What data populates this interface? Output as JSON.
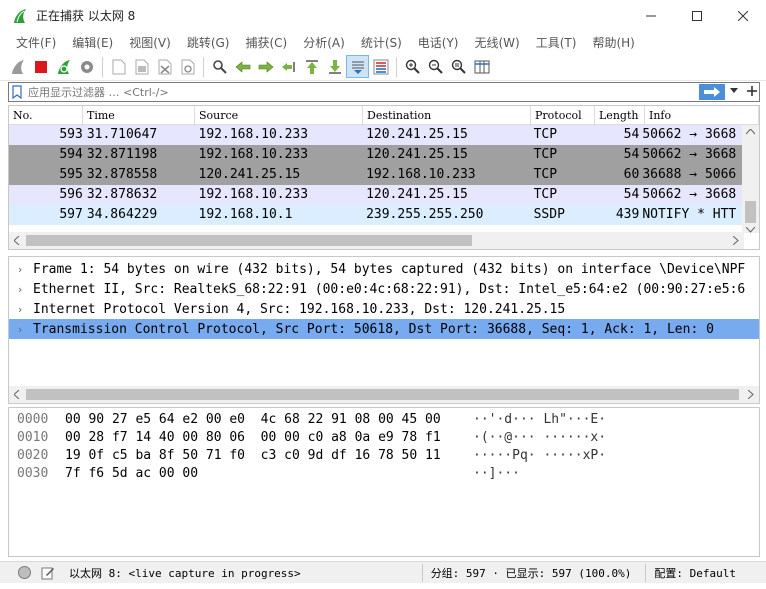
{
  "window": {
    "title": "正在捕获 以太网 8"
  },
  "menu": [
    "文件(F)",
    "编辑(E)",
    "视图(V)",
    "跳转(G)",
    "捕获(C)",
    "分析(A)",
    "统计(S)",
    "电话(Y)",
    "无线(W)",
    "工具(T)",
    "帮助(H)"
  ],
  "filter": {
    "placeholder": "应用显示过滤器 … <Ctrl-/>"
  },
  "packet_list": {
    "columns": [
      "No.",
      "Time",
      "Source",
      "Destination",
      "Protocol",
      "Length",
      "Info"
    ],
    "rows": [
      {
        "no": "593",
        "time": "31.710647",
        "src": "192.168.10.233",
        "dst": "120.241.25.15",
        "proto": "TCP",
        "len": "54",
        "info": "50662 → 3668",
        "bg": "#e7e6ff"
      },
      {
        "no": "594",
        "time": "32.871198",
        "src": "192.168.10.233",
        "dst": "120.241.25.15",
        "proto": "TCP",
        "len": "54",
        "info": "50662 → 3668",
        "bg": "#a0a0a0"
      },
      {
        "no": "595",
        "time": "32.878558",
        "src": "120.241.25.15",
        "dst": "192.168.10.233",
        "proto": "TCP",
        "len": "60",
        "info": "36688 → 5066",
        "bg": "#a0a0a0"
      },
      {
        "no": "596",
        "time": "32.878632",
        "src": "192.168.10.233",
        "dst": "120.241.25.15",
        "proto": "TCP",
        "len": "54",
        "info": "50662 → 3668",
        "bg": "#e7e6ff"
      },
      {
        "no": "597",
        "time": "34.864229",
        "src": "192.168.10.1",
        "dst": "239.255.255.250",
        "proto": "SSDP",
        "len": "439",
        "info": "NOTIFY * HTT",
        "bg": "#daeeff"
      }
    ]
  },
  "details": [
    "Frame 1: 54 bytes on wire (432 bits), 54 bytes captured (432 bits) on interface \\Device\\NPF",
    "Ethernet II, Src: RealtekS_68:22:91 (00:e0:4c:68:22:91), Dst: Intel_e5:64:e2 (00:90:27:e5:6",
    "Internet Protocol Version 4, Src: 192.168.10.233, Dst: 120.241.25.15",
    "Transmission Control Protocol, Src Port: 50618, Dst Port: 36688, Seq: 1, Ack: 1, Len: 0"
  ],
  "bytes": [
    {
      "offset": "0000",
      "hex": "00 90 27 e5 64 e2 00 e0  4c 68 22 91 08 00 45 00",
      "ascii": "··'·d··· Lh\"···E·"
    },
    {
      "offset": "0010",
      "hex": "00 28 f7 14 40 00 80 06  00 00 c0 a8 0a e9 78 f1",
      "ascii": "·(··@··· ······x·"
    },
    {
      "offset": "0020",
      "hex": "19 0f c5 ba 8f 50 71 f0  c3 c0 9d df 16 78 50 11",
      "ascii": "·····Pq· ·····xP·"
    },
    {
      "offset": "0030",
      "hex": "7f f6 5d ac 00 00",
      "ascii": "··]···"
    }
  ],
  "status": {
    "interface": "以太网 8: <live capture in progress>",
    "stats": "分组: 597 · 已显示: 597 (100.0%)",
    "profile": "配置: Default"
  },
  "colors": {
    "selected_detail": "#78aaf0",
    "tcp_row": "#e7e6ff",
    "gray_row": "#a0a0a0",
    "ssdp_row": "#daeeff"
  }
}
